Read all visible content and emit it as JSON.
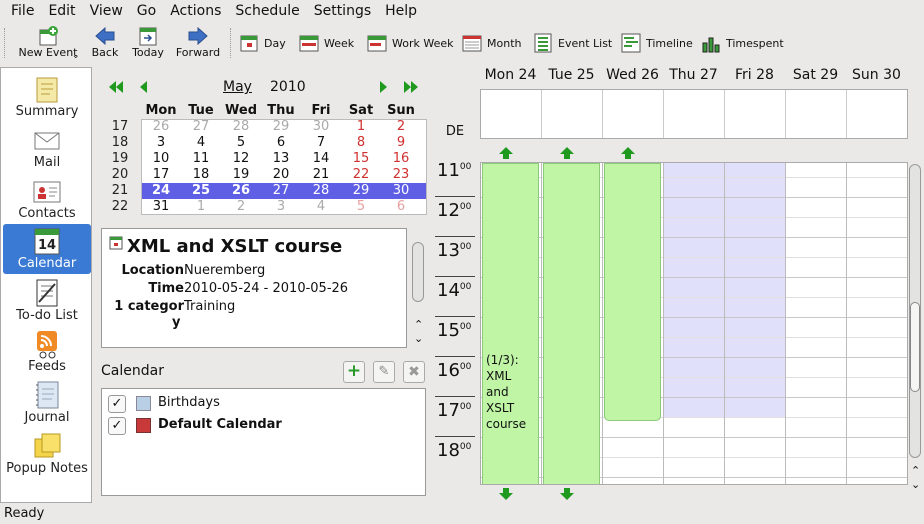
{
  "menu": [
    "File",
    "Edit",
    "View",
    "Go",
    "Actions",
    "Schedule",
    "Settings",
    "Help"
  ],
  "toolbar": {
    "new_event": "New Event",
    "back": "Back",
    "today": "Today",
    "forward": "Forward",
    "day": "Day",
    "week": "Week",
    "work_week": "Work Week",
    "month": "Month",
    "event_list": "Event List",
    "timeline": "Timeline",
    "timespent": "Timespent"
  },
  "sidebar": [
    "Summary",
    "Mail",
    "Contacts",
    "Calendar",
    "To-do List",
    "Feeds",
    "Journal",
    "Popup Notes"
  ],
  "minical": {
    "month": "May",
    "year": "2010",
    "headers": [
      "Mon",
      "Tue",
      "Wed",
      "Thu",
      "Fri",
      "Sat",
      "Sun"
    ],
    "weeks": [
      {
        "wk": "17",
        "days": [
          "26",
          "27",
          "28",
          "29",
          "30",
          "1",
          "2"
        ]
      },
      {
        "wk": "18",
        "days": [
          "3",
          "4",
          "5",
          "6",
          "7",
          "8",
          "9"
        ]
      },
      {
        "wk": "19",
        "days": [
          "10",
          "11",
          "12",
          "13",
          "14",
          "15",
          "16"
        ]
      },
      {
        "wk": "20",
        "days": [
          "17",
          "18",
          "19",
          "20",
          "21",
          "22",
          "23"
        ]
      },
      {
        "wk": "21",
        "days": [
          "24",
          "25",
          "26",
          "27",
          "28",
          "29",
          "30"
        ]
      },
      {
        "wk": "22",
        "days": [
          "31",
          "1",
          "2",
          "3",
          "4",
          "5",
          "6"
        ]
      }
    ]
  },
  "event": {
    "title": "XML and XSLT course",
    "location_label": "Location",
    "location": "Nueremberg",
    "time_label": "Time",
    "time": "2010-05-24 - 2010-05-26",
    "category_label_1": "1 categor",
    "category_label_2": "y",
    "category": "Training"
  },
  "calendar_panel": {
    "title": "Calendar",
    "items": [
      {
        "name": "Birthdays",
        "color": "#b8cfe6"
      },
      {
        "name": "Default Calendar",
        "color": "#c83a3a"
      }
    ]
  },
  "agenda": {
    "days": [
      "Mon 24",
      "Tue 25",
      "Wed 26",
      "Thu 27",
      "Fri 28",
      "Sat 29",
      "Sun 30"
    ],
    "tz": "DE",
    "hours": [
      "11",
      "12",
      "13",
      "14",
      "15",
      "16",
      "17",
      "18"
    ],
    "minutes": "00",
    "event_text": [
      "(1/3):",
      "XML",
      "and",
      "XSLT",
      "course"
    ]
  },
  "status": "Ready"
}
